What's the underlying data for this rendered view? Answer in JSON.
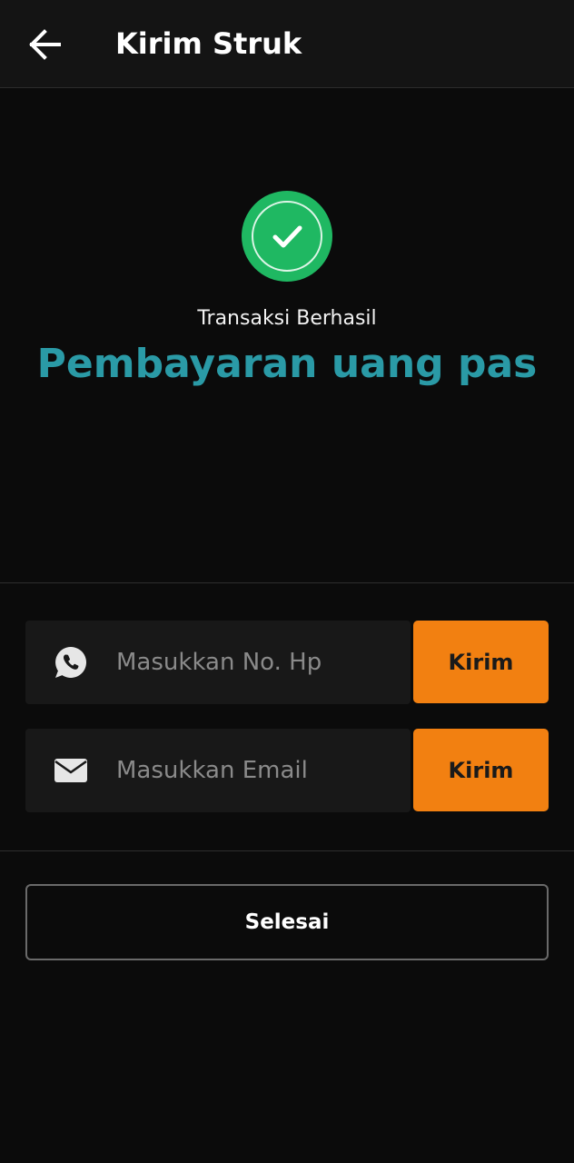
{
  "header": {
    "title": "Kirim Struk",
    "back_icon": "arrow-left-icon"
  },
  "status": {
    "icon": "check-circle-icon",
    "icon_color": "#1fb862",
    "label": "Transaksi Berhasil",
    "title": "Pembayaran uang pas",
    "title_color": "#2a9aa6"
  },
  "send_phone": {
    "icon": "whatsapp-icon",
    "placeholder": "Masukkan No. Hp",
    "value": "",
    "button_label": "Kirim"
  },
  "send_email": {
    "icon": "envelope-icon",
    "placeholder": "Masukkan Email",
    "value": "",
    "button_label": "Kirim"
  },
  "done_button": {
    "label": "Selesai"
  },
  "colors": {
    "accent": "#f28011",
    "background": "#0b0b0b"
  }
}
